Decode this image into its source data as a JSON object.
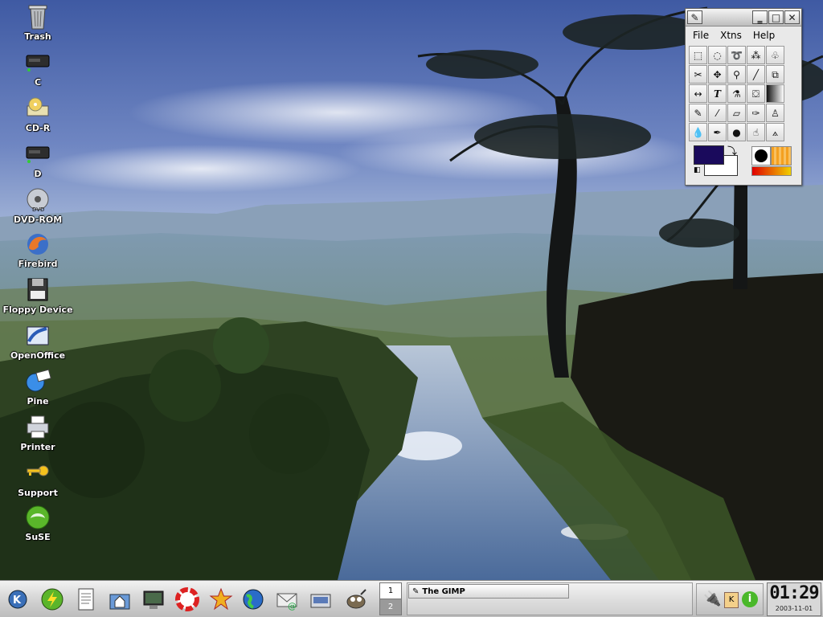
{
  "desktop": {
    "icons": [
      {
        "label": "Trash",
        "icon": "trash-icon"
      },
      {
        "label": "C",
        "icon": "hard-drive-icon"
      },
      {
        "label": "CD-R",
        "icon": "cd-writer-icon"
      },
      {
        "label": "D",
        "icon": "hard-drive-icon"
      },
      {
        "label": "DVD-ROM",
        "icon": "dvd-icon"
      },
      {
        "label": "Firebird",
        "icon": "firebird-browser-icon"
      },
      {
        "label": "Floppy Device",
        "icon": "floppy-icon"
      },
      {
        "label": "OpenOffice",
        "icon": "openoffice-icon"
      },
      {
        "label": "Pine",
        "icon": "mail-globe-icon"
      },
      {
        "label": "Printer",
        "icon": "printer-icon"
      },
      {
        "label": "Support",
        "icon": "key-icon"
      },
      {
        "label": "SuSE",
        "icon": "suse-chameleon-icon"
      }
    ]
  },
  "gimp": {
    "menu": {
      "file": "File",
      "xtns": "Xtns",
      "help": "Help"
    },
    "tools": [
      "rect-select",
      "ellipse-select",
      "lasso-select",
      "magic-wand",
      "bezier-select",
      "intelligent-scissors",
      "move",
      "zoom",
      "crop",
      "transform",
      "flip",
      "text",
      "color-picker",
      "bucket-fill",
      "blend",
      "pencil",
      "paintbrush",
      "eraser",
      "airbrush",
      "clone",
      "convolve",
      "ink",
      "dodge-burn",
      "smudge",
      "measure"
    ],
    "colors": {
      "foreground": "#1a0a5c",
      "background": "#ffffff"
    }
  },
  "taskbar": {
    "quick_launch": [
      "kde-menu-icon",
      "power-icon",
      "text-document-icon",
      "home-folder-icon",
      "monitor-icon",
      "help-lifebuoy-icon",
      "konqueror-star-icon",
      "globe-browser-icon",
      "mail-icon",
      "scanner-icon",
      "gimp-wilber-icon"
    ],
    "pager": [
      "1",
      "2"
    ],
    "task": "The GIMP",
    "tray": [
      "network-plug-icon",
      "klipper-icon",
      "info-icon"
    ],
    "clock": {
      "time": "01:29",
      "date": "2003-11-01"
    }
  }
}
